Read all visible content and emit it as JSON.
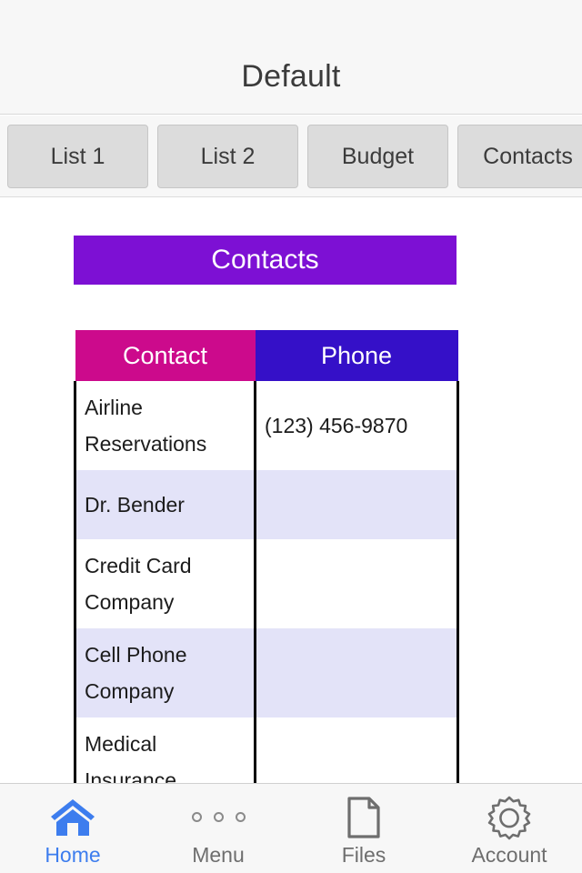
{
  "header": {
    "title": "Default"
  },
  "tabs": [
    {
      "label": "List 1",
      "name": "tab-list-1"
    },
    {
      "label": "List 2",
      "name": "tab-list-2"
    },
    {
      "label": "Budget",
      "name": "tab-budget"
    },
    {
      "label": "Contacts",
      "name": "tab-contacts"
    }
  ],
  "section": {
    "banner_label": "Contacts",
    "banner_color": "#7d10d4"
  },
  "table": {
    "columns": [
      {
        "label": "Contact",
        "color": "#cc0a8c"
      },
      {
        "label": "Phone",
        "color": "#3510c8"
      }
    ],
    "rows": [
      {
        "contact": "Airline Reservations",
        "phone": "(123) 456-9870"
      },
      {
        "contact": "Dr. Bender",
        "phone": ""
      },
      {
        "contact": "Credit Card Company",
        "phone": ""
      },
      {
        "contact": "Cell Phone Company",
        "phone": ""
      },
      {
        "contact": "Medical Insurance",
        "phone": ""
      }
    ],
    "alt_row_color": "#e3e3f8"
  },
  "bottom_nav": {
    "active_color": "#3d7dee",
    "inactive_color": "#6e6e6e",
    "items": [
      {
        "label": "Home",
        "icon": "home-icon",
        "active": true
      },
      {
        "label": "Menu",
        "icon": "dots-menu-icon",
        "active": false
      },
      {
        "label": "Files",
        "icon": "document-icon",
        "active": false
      },
      {
        "label": "Account",
        "icon": "gear-icon",
        "active": false
      }
    ]
  }
}
